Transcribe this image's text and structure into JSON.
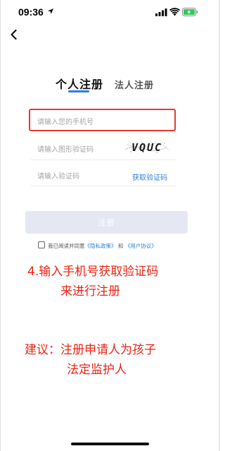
{
  "status_bar": {
    "time": "09:36",
    "icons": [
      "location-arrow-icon",
      "signal-icon",
      "wifi-icon",
      "battery-charging-icon"
    ]
  },
  "nav": {
    "back_icon": "chevron-left-icon"
  },
  "tabs": [
    {
      "label": "个人注册",
      "active": true
    },
    {
      "label": "法人注册",
      "active": false
    }
  ],
  "form": {
    "phone_placeholder": "请输入您的手机号",
    "captcha_placeholder": "请输入图形验证码",
    "captcha_text": "VQUC",
    "sms_code_placeholder": "请输入验证码",
    "get_code_label": "获取验证码",
    "register_label": "注册",
    "agreement": {
      "prefix": "我已阅读并同意",
      "privacy_link": "《隐私政策》",
      "and": "和",
      "terms_link": "《用户协议》"
    }
  },
  "annotations": {
    "step_line1": "4.输入手机号获取验证码",
    "step_line2": "来进行注册",
    "advice_line1": "建议：注册申请人为孩子",
    "advice_line2": "法定监护人"
  },
  "colors": {
    "accent": "#2e7be5",
    "link": "#2f80d8",
    "highlight_red": "#e53935",
    "annotation_red": "#ee2211",
    "button_disabled": "#e5e8f3"
  }
}
